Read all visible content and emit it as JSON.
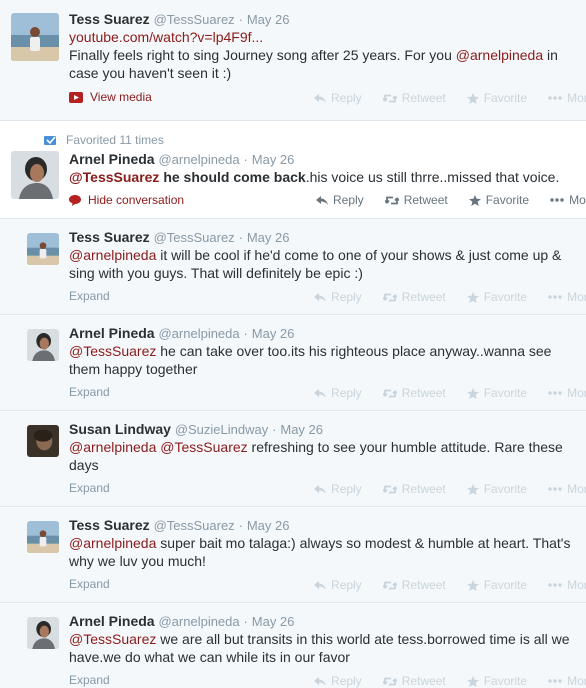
{
  "actions": {
    "reply": "Reply",
    "retweet": "Retweet",
    "favorite": "Favorite",
    "more": "More"
  },
  "tweets": [
    {
      "name": "Tess Suarez",
      "handle": "@TessSuarez",
      "date": "May 26",
      "link": "youtube.com/watch?v=lp4F9f...",
      "text_a": "Finally feels right to sing Journey song after 25 years.  For you ",
      "mention1": "@arnelpineda",
      "text_b": " in case you haven't seen it :)",
      "media_label": "View media"
    },
    {
      "favorited_label": "Favorited 11 times",
      "name": "Arnel Pineda",
      "handle": "@arnelpineda",
      "date": "May 26",
      "mention1": "@TessSuarez",
      "bold_text": " he should come back",
      "text_a": ".his voice us still thrre..missed that voice.",
      "hide_label": "Hide conversation"
    },
    {
      "name": "Tess Suarez",
      "handle": "@TessSuarez",
      "date": "May 26",
      "mention1": "@arnelpineda",
      "text_a": " it will be cool if he'd come to one of your shows & just come up & sing with you guys. That will definitely be epic :)",
      "expand": "Expand"
    },
    {
      "name": "Arnel Pineda",
      "handle": "@arnelpineda",
      "date": "May 26",
      "mention1": "@TessSuarez",
      "text_a": " he can take over too.its his righteous place anyway..wanna see them happy together",
      "expand": "Expand"
    },
    {
      "name": "Susan Lindway",
      "handle": "@SuzieLindway",
      "date": "May 26",
      "mention1": "@arnelpineda",
      "mention2": "@TessSuarez",
      "text_a": " refreshing to see your humble attitude. Rare these days",
      "expand": "Expand"
    },
    {
      "name": "Tess Suarez",
      "handle": "@TessSuarez",
      "date": "May 26",
      "mention1": "@arnelpineda",
      "text_a": " super bait mo talaga:) always so modest & humble at heart. That's why we luv you much!",
      "expand": "Expand"
    },
    {
      "name": "Arnel Pineda",
      "handle": "@arnelpineda",
      "date": "May 26",
      "mention1": "@TessSuarez",
      "text_a": " we are all but transits in this world ate tess.borrowed time is all we have.we do what we can while its in our favor",
      "expand": "Expand"
    }
  ]
}
